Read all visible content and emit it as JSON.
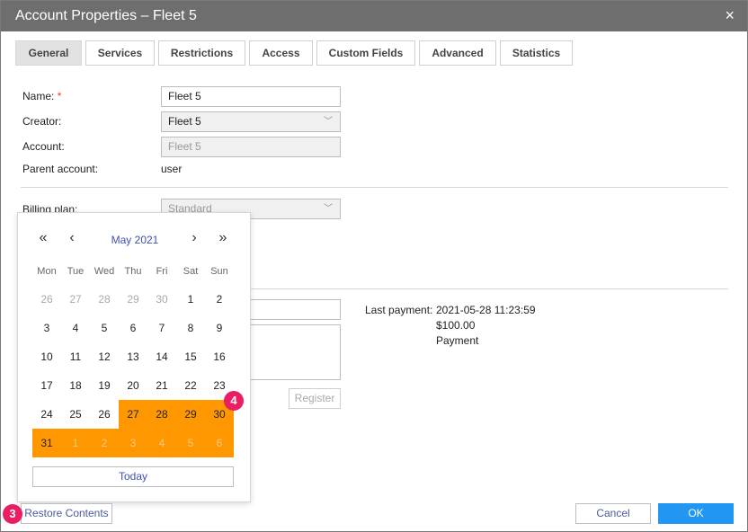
{
  "window": {
    "title": "Account Properties – Fleet 5",
    "close_icon": "×"
  },
  "tabs": [
    {
      "label": "General",
      "active": true
    },
    {
      "label": "Services"
    },
    {
      "label": "Restrictions"
    },
    {
      "label": "Access"
    },
    {
      "label": "Custom Fields"
    },
    {
      "label": "Advanced"
    },
    {
      "label": "Statistics"
    }
  ],
  "form": {
    "name_label": "Name:",
    "required_mark": "*",
    "name_value": "Fleet 5",
    "creator_label": "Creator:",
    "creator_value": "Fleet 5",
    "account_label": "Account:",
    "account_value": "Fleet 5",
    "parent_label": "Parent account:",
    "parent_value": "user",
    "billing_label": "Billing plan:",
    "billing_value": "Standard"
  },
  "payment": {
    "last_payment_label": "Last payment:",
    "date": "2021-05-28 11:23:59",
    "amount": "$100.00",
    "type": "Payment",
    "register_label": "Register"
  },
  "calendar": {
    "month_label": "May 2021",
    "nav": {
      "prev_year": "«",
      "prev_month": "‹",
      "next_month": "›",
      "next_year": "»"
    },
    "weekdays": [
      "Mon",
      "Tue",
      "Wed",
      "Thu",
      "Fri",
      "Sat",
      "Sun"
    ],
    "weeks": [
      [
        "26",
        "27",
        "28",
        "29",
        "30",
        "1",
        "2"
      ],
      [
        "3",
        "4",
        "5",
        "6",
        "7",
        "8",
        "9"
      ],
      [
        "10",
        "11",
        "12",
        "13",
        "14",
        "15",
        "16"
      ],
      [
        "17",
        "18",
        "19",
        "20",
        "21",
        "22",
        "23"
      ],
      [
        "24",
        "25",
        "26",
        "27",
        "28",
        "29",
        "30"
      ],
      [
        "31",
        "1",
        "2",
        "3",
        "4",
        "5",
        "6"
      ]
    ],
    "other_month": [
      [
        true,
        true,
        true,
        true,
        true,
        false,
        false
      ],
      [
        false,
        false,
        false,
        false,
        false,
        false,
        false
      ],
      [
        false,
        false,
        false,
        false,
        false,
        false,
        false
      ],
      [
        false,
        false,
        false,
        false,
        false,
        false,
        false
      ],
      [
        false,
        false,
        false,
        false,
        false,
        false,
        false
      ],
      [
        false,
        true,
        true,
        true,
        true,
        true,
        true
      ]
    ],
    "selected": [
      [
        false,
        false,
        false,
        false,
        false,
        false,
        false
      ],
      [
        false,
        false,
        false,
        false,
        false,
        false,
        false
      ],
      [
        false,
        false,
        false,
        false,
        false,
        false,
        false
      ],
      [
        false,
        false,
        false,
        false,
        false,
        false,
        false
      ],
      [
        false,
        false,
        false,
        true,
        true,
        true,
        true
      ],
      [
        true,
        true,
        true,
        true,
        true,
        true,
        true
      ]
    ],
    "today_label": "Today",
    "selection_color": "#ff9800"
  },
  "footer": {
    "restore_label": "Restore Contents",
    "cancel_label": "Cancel",
    "ok_label": "OK"
  },
  "markers": {
    "step3": "3",
    "step4": "4"
  },
  "colors": {
    "accent": "#2196f3",
    "titlebar": "#6e6e6e",
    "marker": "#e91e63",
    "link": "#3f51b5"
  }
}
